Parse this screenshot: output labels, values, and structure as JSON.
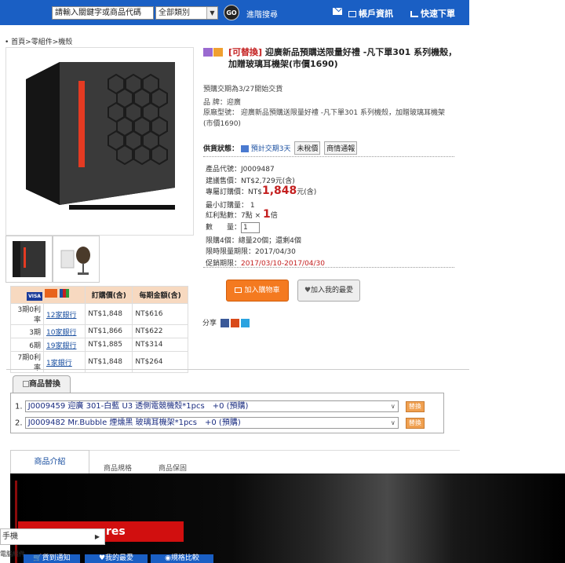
{
  "topbar": {
    "search_placeholder": "請輸入關鍵字或商品代碼",
    "category": "全部類別",
    "go": "GO",
    "advanced_search": "進階搜尋",
    "account": "帳戶資訊",
    "quick_order": "快速下單"
  },
  "breadcrumb": "• 首頁>零組件>機殼",
  "product": {
    "tag": "[可替換]",
    "title": "迎廣新品預購送限量好禮 -凡下單301 系列機殼，加贈玻璃耳機架(市價1690)",
    "preorder": "預購交期為3/27開始交貨",
    "brand": "品 牌：迎廣",
    "orig_model": "原廠型號： 迎廣新品預購送限量好禮 -凡下單301 系列機殼，加贈玻璃耳機架(市價1690)",
    "supply_label": "供貨狀態：",
    "supply_status": "預計交期3天",
    "tax_excluded": "未稅價",
    "contact": "商情通報",
    "code": "產品代號：J0009487",
    "msrp": "建議售價：NT$2,729元(含)",
    "member_price_label": "專屬訂購價：NT$",
    "member_price": "1,848",
    "member_price_suffix": "元(含)",
    "min_qty": "最小訂購量： 1",
    "bonus_label": "紅利點數：7點 × ",
    "bonus_mult": "1",
    "bonus_suffix": "倍",
    "qty_label": "數　　量：",
    "qty_value": "1",
    "limit": "限購4個：總量20個；還剩4個",
    "deadline": "限時限量期限：2017/04/30",
    "promo_label": "促銷期限：",
    "promo_period": "2017/03/10-2017/04/30",
    "add_cart": "加入購物車",
    "add_fav": "加入我的最愛",
    "share": "分享"
  },
  "installments": {
    "headers": [
      "",
      "",
      "訂購價(含)",
      "每期金額(含)"
    ],
    "rows": [
      {
        "label": "3期0利率",
        "stores": "12家銀行",
        "price": "NT$1,848",
        "monthly": "NT$616"
      },
      {
        "label": "3期",
        "stores": "10家銀行",
        "price": "NT$1,866",
        "monthly": "NT$622"
      },
      {
        "label": "6期",
        "stores": "19家銀行",
        "price": "NT$1,885",
        "monthly": "NT$314"
      },
      {
        "label": "7期0利率",
        "stores": "1家銀行",
        "price": "NT$1,848",
        "monthly": "NT$264"
      }
    ]
  },
  "replacement": {
    "tab": "商品替換",
    "items": [
      {
        "index": "1.",
        "text": "J0009459 迎廣 301-白藍 U3 透側電競機殼*1pcs　+0 (預購)",
        "button": "替換"
      },
      {
        "index": "2.",
        "text": "J0009482 Mr.Bubble 煙燻黑 玻璃耳機架*1pcs　+0 (預購)",
        "button": "替換"
      }
    ]
  },
  "detail_tabs": [
    "商品介紹",
    "商品規格",
    "商品保固"
  ],
  "banner_text": "res",
  "popup_menu": "手機",
  "bottom_bar": [
    "貨到通知",
    "我的最愛",
    "規格比較"
  ],
  "bottom_cut": "電腦組件"
}
